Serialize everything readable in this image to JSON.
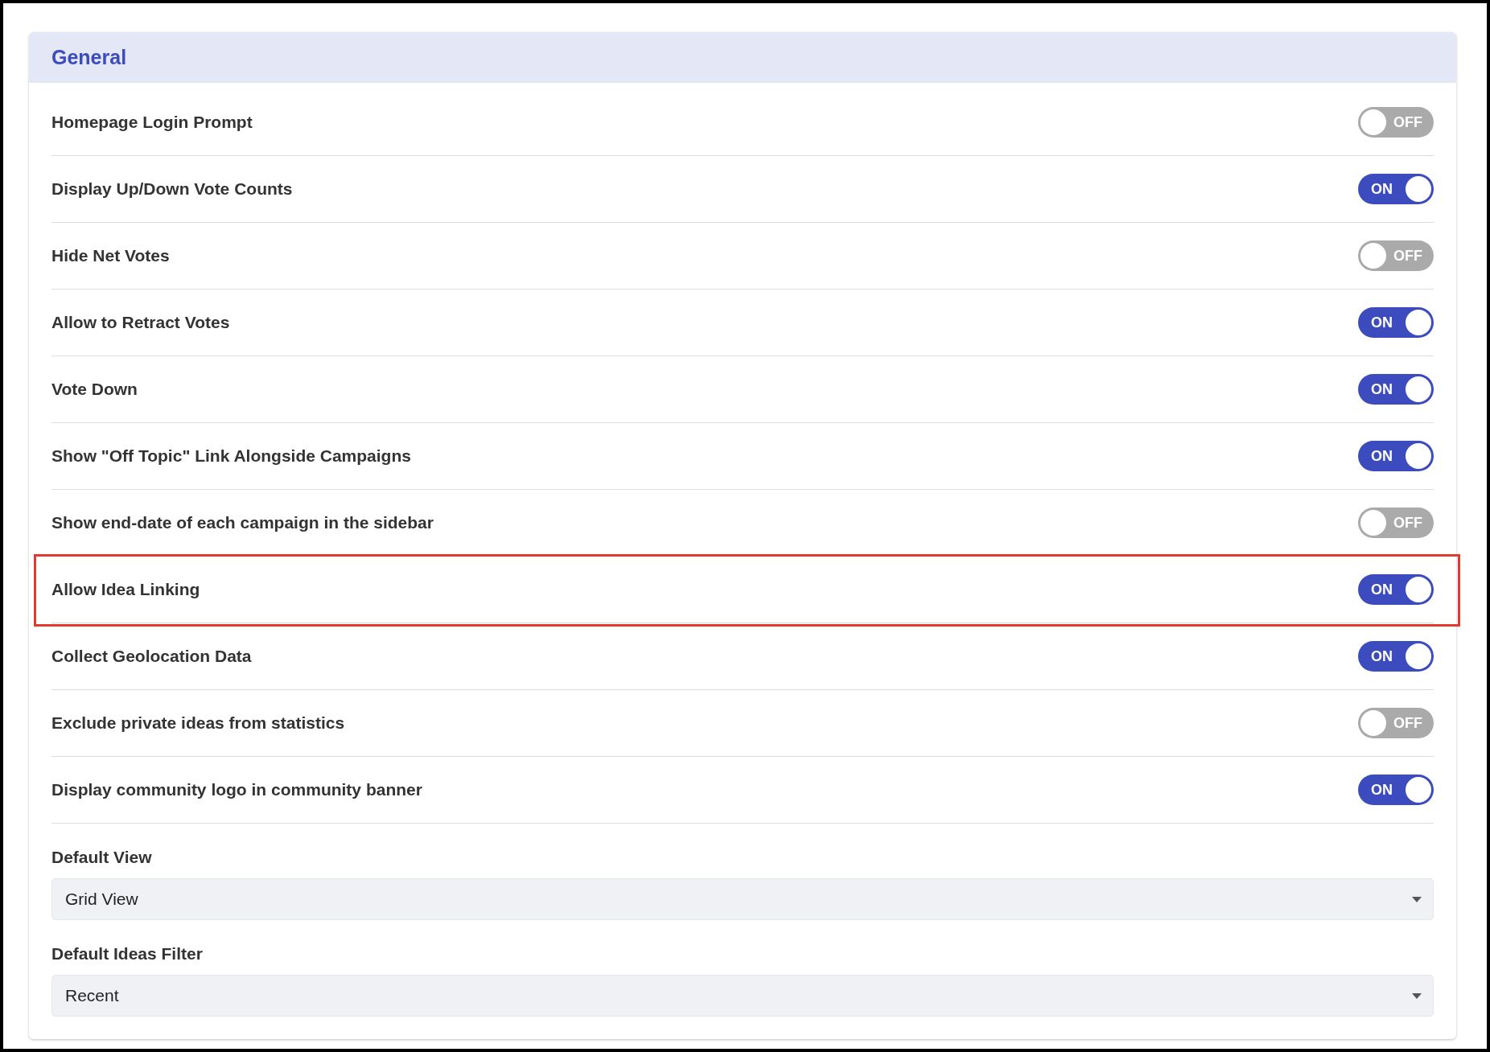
{
  "section": {
    "title": "General"
  },
  "settings": [
    {
      "label": "Homepage Login Prompt",
      "on": false,
      "highlighted": false,
      "state_text": "OFF"
    },
    {
      "label": "Display Up/Down Vote Counts",
      "on": true,
      "highlighted": false,
      "state_text": "ON"
    },
    {
      "label": "Hide Net Votes",
      "on": false,
      "highlighted": false,
      "state_text": "OFF"
    },
    {
      "label": "Allow to Retract Votes",
      "on": true,
      "highlighted": false,
      "state_text": "ON"
    },
    {
      "label": "Vote Down",
      "on": true,
      "highlighted": false,
      "state_text": "ON"
    },
    {
      "label": "Show \"Off Topic\" Link Alongside Campaigns",
      "on": true,
      "highlighted": false,
      "state_text": "ON"
    },
    {
      "label": "Show end-date of each campaign in the sidebar",
      "on": false,
      "highlighted": false,
      "state_text": "OFF"
    },
    {
      "label": "Allow Idea Linking",
      "on": true,
      "highlighted": true,
      "state_text": "ON"
    },
    {
      "label": "Collect Geolocation Data",
      "on": true,
      "highlighted": false,
      "state_text": "ON"
    },
    {
      "label": "Exclude private ideas from statistics",
      "on": false,
      "highlighted": false,
      "state_text": "OFF"
    },
    {
      "label": "Display community logo in community banner",
      "on": true,
      "highlighted": false,
      "state_text": "ON"
    }
  ],
  "selects": [
    {
      "label": "Default View",
      "value": "Grid View"
    },
    {
      "label": "Default Ideas Filter",
      "value": "Recent"
    }
  ]
}
